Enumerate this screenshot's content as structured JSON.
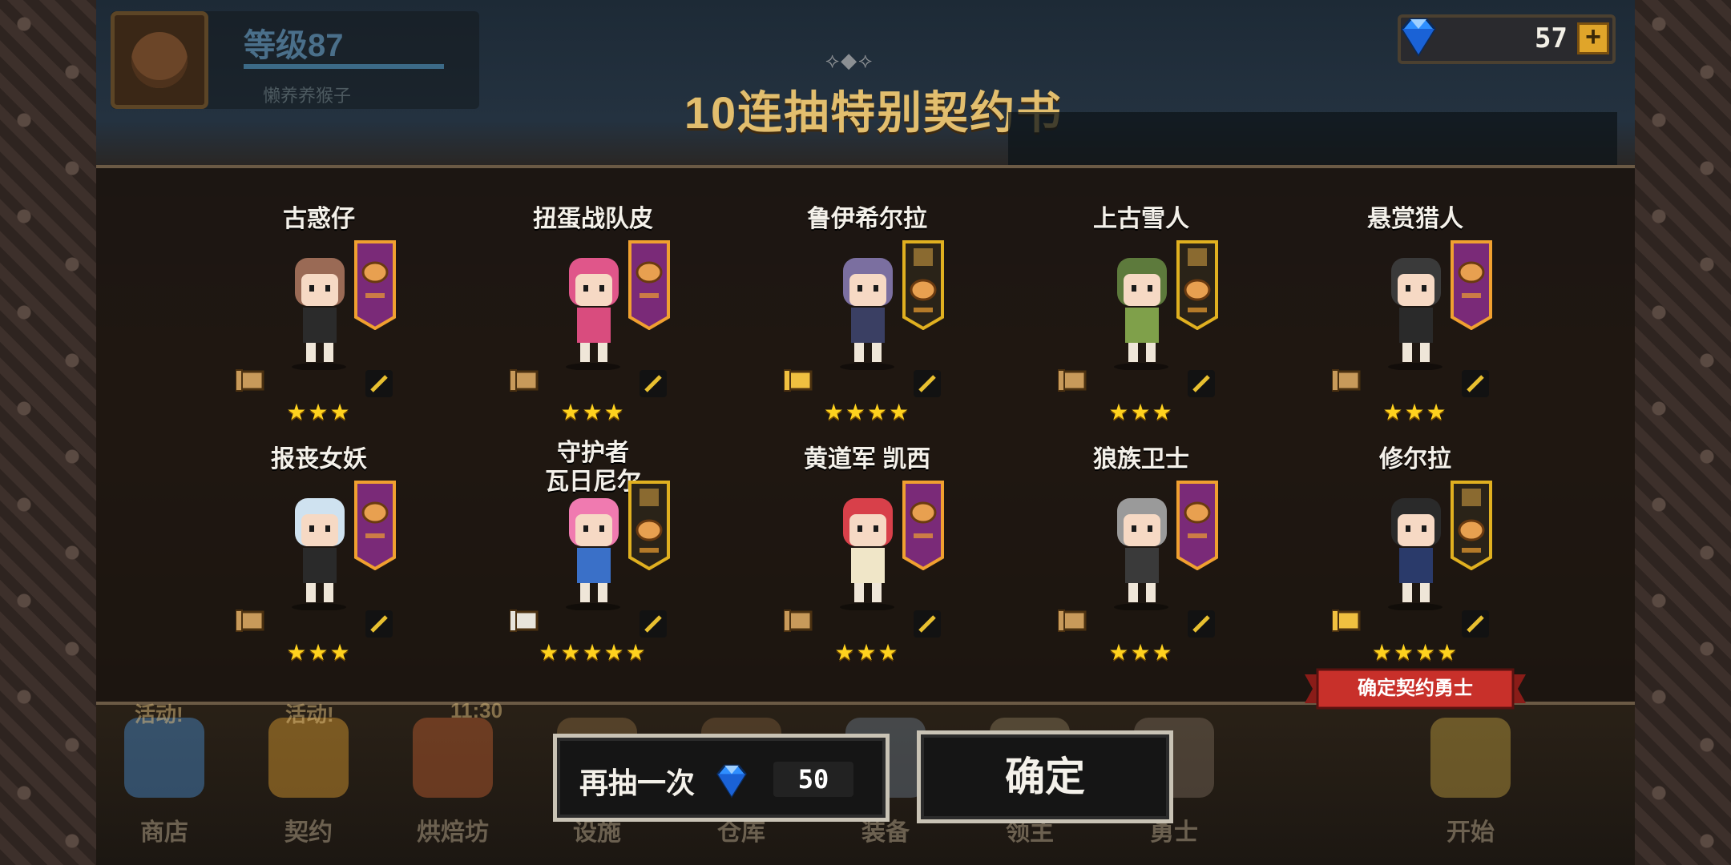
{
  "player": {
    "level_label": "等级87",
    "name": "懒养养猴子"
  },
  "currency": {
    "gems": "57",
    "add_label": "+"
  },
  "ornament": "⟡◆⟡",
  "title": "10连抽特别契约书",
  "heroes": [
    {
      "name": "古惑仔",
      "stars": "★★★",
      "hair": "#9a6a55",
      "outfit": "#2b2b2b",
      "banner_color": "#7a2a78"
    },
    {
      "name": "扭蛋战队皮",
      "stars": "★★★",
      "hair": "#e0568a",
      "outfit": "#d94c7e",
      "banner_color": "#7a2a78"
    },
    {
      "name": "鲁伊希尔拉",
      "stars": "★★★★",
      "hair": "#7b6fa0",
      "outfit": "#3a3f63",
      "banner_color": "#2a2318"
    },
    {
      "name": "上古雪人",
      "stars": "★★★",
      "hair": "#5d7a3c",
      "outfit": "#7fa04a",
      "banner_color": "#2a2318"
    },
    {
      "name": "悬赏猎人",
      "stars": "★★★",
      "hair": "#3a3a3a",
      "outfit": "#2a2a2a",
      "banner_color": "#7a2a78"
    },
    {
      "name": "报丧女妖",
      "stars": "★★★",
      "hair": "#cfe2f0",
      "outfit": "#2a2a2a",
      "banner_color": "#7a2a78"
    },
    {
      "name": "守护者\n瓦日尼尔",
      "stars": "★★★★★",
      "hair": "#f07ab0",
      "outfit": "#3a70c8",
      "banner_color": "#2a2318"
    },
    {
      "name": "黄道军 凯西",
      "stars": "★★★",
      "hair": "#d8404a",
      "outfit": "#f0e6c8",
      "banner_color": "#7a2a78"
    },
    {
      "name": "狼族卫士",
      "stars": "★★★",
      "hair": "#9a9a9a",
      "outfit": "#3a3a3a",
      "banner_color": "#7a2a78"
    },
    {
      "name": "修尔拉",
      "stars": "★★★★",
      "hair": "#2a2a2a",
      "outfit": "#2a3a6a",
      "banner_color": "#2a2318"
    }
  ],
  "confirm_tag": "确定契约勇士",
  "bottom_nav": [
    {
      "label": "商店",
      "color": "#4a8fd0"
    },
    {
      "label": "契约",
      "color": "#e0a030"
    },
    {
      "label": "烘焙坊",
      "color": "#c06030"
    },
    {
      "label": "设施",
      "color": "#8a6a40"
    },
    {
      "label": "仓库",
      "color": "#7a5a3a"
    },
    {
      "label": "装备",
      "color": "#6a7a8a"
    },
    {
      "label": "领主",
      "color": "#8a7a5a"
    },
    {
      "label": "勇士",
      "color": "#7a6a5a"
    },
    {
      "label": "开始",
      "color": "#c0a040"
    }
  ],
  "bottom_nav_badges": {
    "activity_1": "活动!",
    "activity_2": "活动!",
    "timer": "11:30"
  },
  "buttons": {
    "again_label": "再抽一次",
    "again_cost": "50",
    "confirm_label": "确定"
  },
  "colors": {
    "gold_text": "#e2be6e",
    "star": "#ffd21e",
    "gem_blue": "#2f8fff",
    "tag_red": "#c8302a"
  }
}
